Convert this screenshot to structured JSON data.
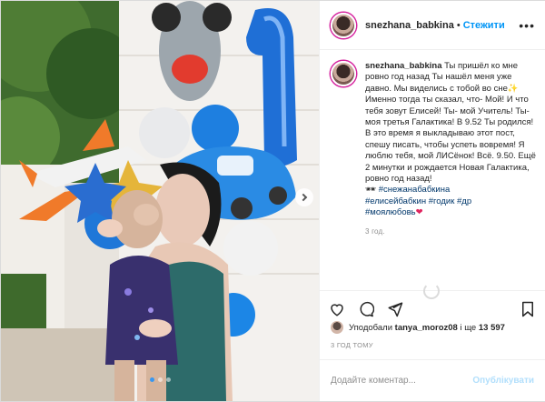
{
  "post": {
    "author": "snezhana_babkina",
    "follow_label": "Стежити",
    "separator": "•",
    "more_icon": "ellipsis-icon"
  },
  "caption": {
    "author": "snezhana_babkina",
    "text": "Ты пришёл ко мне ровно год назад⁣ Ты нашёл меня уже давно. Мы виделись с тобой во сне✨ Именно тогда ты сказал, что- Мой! И что тебя зовут Елисей!⁣ Ты- мой Учитель! Ты-моя третья Галактика! В 9.52 Ты родился! В это время я выкладываю этот пост, спешу писать, чтобы успеть вовремя! Я люблю тебя, мой ЛИСёнок! Всё. 9.50. Ещё 2 минутки и рождается Новая Галактика, ровно год назад!",
    "hashtags_line1": "#снежанабабкина",
    "hashtags_line2": "#елисейбабкин #годик #др",
    "hashtags_line3": "#моялюбовь",
    "emoji_leading": "🕶",
    "emoji_heart": "❤",
    "time": "3 год."
  },
  "likes": {
    "prefix": "Уподобали",
    "user": "tanya_moroz08",
    "conjunction": "і ще",
    "count": "13 597"
  },
  "posted_ago": "3 ГОД ТОМУ",
  "comment": {
    "placeholder": "Додайте коментар...",
    "post_label": "Опублікувати"
  },
  "carousel": {
    "dots": 3,
    "active": 0
  },
  "colors": {
    "link": "#0095f6",
    "hashtag": "#00376b",
    "muted": "#8e8e8e",
    "post_disabled": "#b2dffc"
  }
}
